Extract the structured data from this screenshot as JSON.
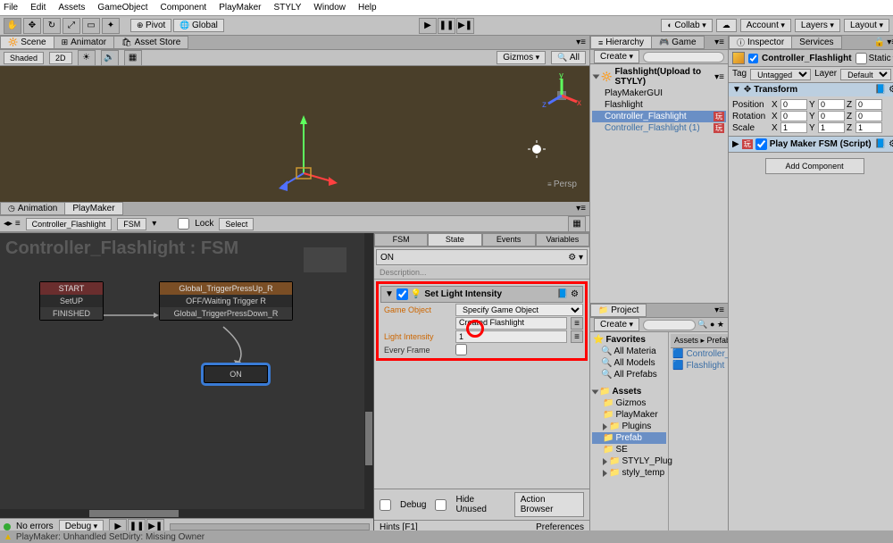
{
  "menu": [
    "File",
    "Edit",
    "Assets",
    "GameObject",
    "Component",
    "PlayMaker",
    "STYLY",
    "Window",
    "Help"
  ],
  "top_toolbar": {
    "pivot": "Pivot",
    "global": "Global",
    "collab": "Collab",
    "account": "Account",
    "layers": "Layers",
    "layout": "Layout"
  },
  "scene_tabs": {
    "scene": "Scene",
    "animator": "Animator",
    "asset_store": "Asset Store"
  },
  "scene_toolbar": {
    "shaded": "Shaded",
    "mode2d": "2D",
    "gizmos": "Gizmos",
    "all": "All"
  },
  "scene": {
    "persp_label": "Persp"
  },
  "ani_tabs": {
    "animation": "Animation",
    "playmaker": "PlayMaker"
  },
  "pm": {
    "crumbs_obj": "Controller_Flashlight",
    "crumbs_fsm": "FSM",
    "lock": "Lock",
    "select": "Select",
    "title": "Controller_Flashlight : FSM",
    "state_start_title": "START",
    "state_start_trans": "SetUP",
    "state_start_footer": "FINISHED",
    "state_off_title": "Global_TriggerPressUp_R",
    "state_off_body": "OFF/Waiting Trigger R",
    "state_off_footer": "Global_TriggerPressDown_R",
    "state_on_body": "ON",
    "no_errors": "No errors",
    "debug": "Debug",
    "subtabs": [
      "FSM",
      "State",
      "Events",
      "Variables"
    ],
    "state_name": "ON",
    "desc_placeholder": "Description...",
    "action_title": "Set Light Intensity",
    "game_object": "Game Object",
    "go_value_dd": "Specify Game Object",
    "go_value_field": "Created Flashlight",
    "light_intensity": "Light Intensity",
    "li_value": "1",
    "every_frame": "Every Frame",
    "debug_chk": "Debug",
    "hide_unused": "Hide Unused",
    "action_browser": "Action Browser",
    "hints": "Hints [F1]",
    "prefs": "Preferences"
  },
  "hierarchy": {
    "tab": "Hierarchy",
    "game_tab": "Game",
    "create": "Create",
    "scene_name": "Flashlight(Upload to STYLY)",
    "items": [
      "PlayMakerGUI",
      "Flashlight",
      "Controller_Flashlight",
      "Controller_Flashlight (1)"
    ]
  },
  "project": {
    "tab": "Project",
    "create": "Create",
    "favorites": "Favorites",
    "fav_items": [
      "All Materia",
      "All Models",
      "All Prefabs"
    ],
    "assets": "Assets",
    "folders": [
      "Gizmos",
      "PlayMaker",
      "Plugins",
      "Prefab",
      "SE",
      "STYLY_Plug",
      "styly_temp"
    ],
    "crumb": "Assets ▸ Prefab",
    "asset_items": [
      "Controller_Flas",
      "Flashlight"
    ]
  },
  "inspector": {
    "tab_i": "Inspector",
    "tab_s": "Services",
    "name": "Controller_Flashlight",
    "static": "Static",
    "tag": "Tag",
    "tag_v": "Untagged",
    "layer": "Layer",
    "layer_v": "Default",
    "transform": "Transform",
    "pos": "Position",
    "rot": "Rotation",
    "scl": "Scale",
    "p": {
      "x": "0",
      "y": "0",
      "z": "0"
    },
    "r": {
      "x": "0",
      "y": "0",
      "z": "0"
    },
    "s": {
      "x": "1",
      "y": "1",
      "z": "1"
    },
    "pm_fsm": "Play Maker FSM (Script)",
    "add_component": "Add Component"
  },
  "status": "PlayMaker: Unhandled SetDirty: Missing Owner"
}
